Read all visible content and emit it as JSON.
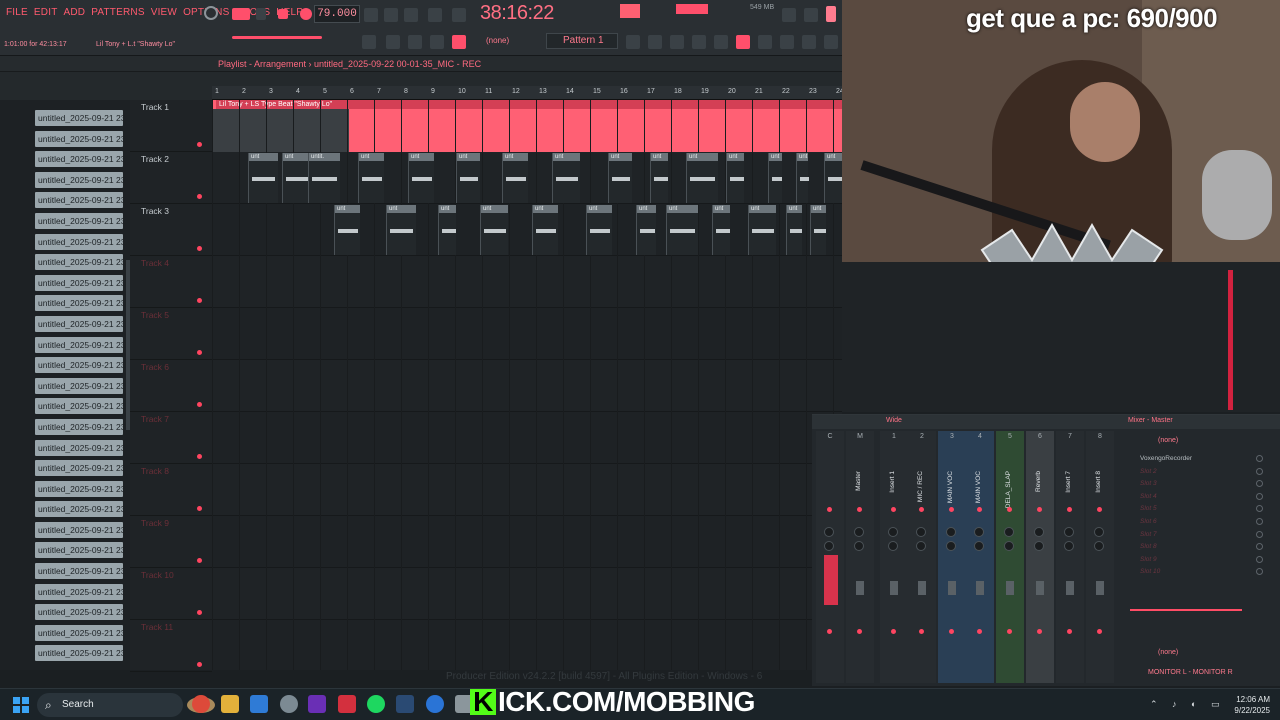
{
  "menu": [
    "FILE",
    "EDIT",
    "ADD",
    "PATTERNS",
    "VIEW",
    "OPTIONS",
    "TOOLS",
    "HELP"
  ],
  "toolbar": {
    "tempo": "79.000",
    "clock": "38:16:22",
    "memory": "549 MB",
    "status": "1:01:00 for 42:13:17",
    "hint_title": "Lil Tony + L.t \"Shawty Lo\"",
    "pattern": "Pattern 1",
    "none": "(none)"
  },
  "playlist": {
    "title": "Playlist - Arrangement › untitled_2025-09-22 00-01-35_MIC - REC",
    "ruler": [
      "1",
      "2",
      "3",
      "4",
      "5",
      "6",
      "7",
      "8",
      "9",
      "10",
      "11",
      "12",
      "13",
      "14",
      "15",
      "16",
      "17",
      "18",
      "19",
      "20",
      "21",
      "22",
      "23",
      "24"
    ],
    "big_clip_title": "Lil Tony + LS Type Beat \"Shawty Lo\"",
    "small_clip_label": "unt",
    "small_clip_label_long": "untit.",
    "tracks": [
      "Track 1",
      "Track 2",
      "Track 3",
      "Track 4",
      "Track 5",
      "Track 6",
      "Track 7",
      "Track 8",
      "Track 9",
      "Track 10",
      "Track 11"
    ]
  },
  "browser": {
    "item_label": "untitled_2025-09-21 23-",
    "count": 27
  },
  "overlay": {
    "counter": "get que a pc: 690/900",
    "kick": "ICK.COM/MOBBING"
  },
  "mixer": {
    "title": "Mixer - Master",
    "wide": "Wide",
    "none": "(none)",
    "monitor": "MONITOR L - MONITOR R",
    "strips": [
      {
        "num": "C",
        "name": ""
      },
      {
        "num": "M",
        "name": "Master"
      },
      {
        "num": "1",
        "name": "Insert 1"
      },
      {
        "num": "2",
        "name": "MIC / REC"
      },
      {
        "num": "3",
        "name": "MAIN VOC"
      },
      {
        "num": "4",
        "name": "MAIN VOC"
      },
      {
        "num": "5",
        "name": "DELA_SLAP"
      },
      {
        "num": "6",
        "name": "Reverb"
      },
      {
        "num": "7",
        "name": "Insert 7"
      },
      {
        "num": "8",
        "name": "Insert 8"
      }
    ],
    "slots": [
      "VoxengoRecorder",
      "Slot 2",
      "Slot 3",
      "Slot 4",
      "Slot 5",
      "Slot 6",
      "Slot 7",
      "Slot 8",
      "Slot 9",
      "Slot 10"
    ]
  },
  "footer": {
    "edition": "Producer Edition v24.2.2 [build 4597] - All Plugins Edition - Windows - 6"
  },
  "taskbar": {
    "search": "Search",
    "time": "12:06 AM",
    "date": "9/22/2025"
  },
  "colors": {
    "accent": "#ff5a6e",
    "clip": "#ff6074",
    "kick_green": "#53fc18"
  }
}
